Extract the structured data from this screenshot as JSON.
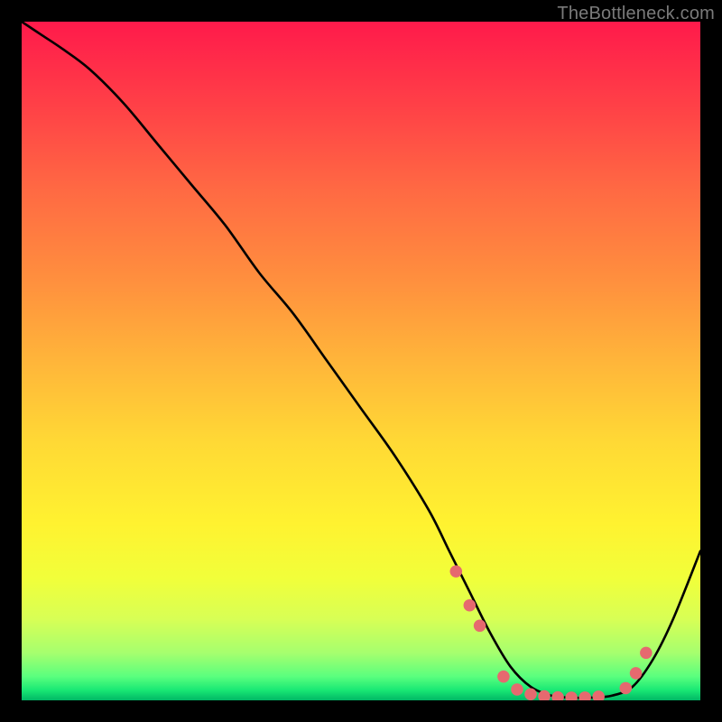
{
  "watermark": "TheBottleneck.com",
  "gradient_stops": [
    {
      "offset": 0.0,
      "color": "#ff1a4b"
    },
    {
      "offset": 0.12,
      "color": "#ff3f47"
    },
    {
      "offset": 0.25,
      "color": "#ff6a43"
    },
    {
      "offset": 0.38,
      "color": "#ff8f3e"
    },
    {
      "offset": 0.5,
      "color": "#ffb53a"
    },
    {
      "offset": 0.62,
      "color": "#ffd935"
    },
    {
      "offset": 0.74,
      "color": "#fff230"
    },
    {
      "offset": 0.82,
      "color": "#f1ff3a"
    },
    {
      "offset": 0.88,
      "color": "#d8ff55"
    },
    {
      "offset": 0.93,
      "color": "#a6ff6e"
    },
    {
      "offset": 0.965,
      "color": "#5aff7e"
    },
    {
      "offset": 0.985,
      "color": "#19e874"
    },
    {
      "offset": 1.0,
      "color": "#00b765"
    }
  ],
  "chart_data": {
    "type": "line",
    "title": "",
    "xlabel": "",
    "ylabel": "",
    "xlim": [
      0,
      100
    ],
    "ylim": [
      0,
      100
    ],
    "series": [
      {
        "name": "curve",
        "x": [
          0,
          3,
          6,
          10,
          15,
          20,
          25,
          30,
          35,
          40,
          45,
          50,
          55,
          60,
          63,
          66,
          69,
          72,
          75,
          78,
          81,
          84,
          87,
          90,
          93,
          96,
          100
        ],
        "y": [
          100,
          98,
          96,
          93,
          88,
          82,
          76,
          70,
          63,
          57,
          50,
          43,
          36,
          28,
          22,
          16,
          10,
          5,
          2,
          0.7,
          0.4,
          0.4,
          0.7,
          2,
          6,
          12,
          22
        ]
      }
    ],
    "markers": {
      "name": "highlight-dots",
      "color": "#e6696f",
      "x": [
        64.0,
        66.0,
        67.5,
        71.0,
        73.0,
        75.0,
        77.0,
        79.0,
        81.0,
        83.0,
        85.0,
        89.0,
        90.5,
        92.0
      ],
      "y": [
        19.0,
        14.0,
        11.0,
        3.5,
        1.6,
        0.9,
        0.6,
        0.45,
        0.4,
        0.42,
        0.55,
        1.8,
        4.0,
        7.0
      ]
    }
  }
}
